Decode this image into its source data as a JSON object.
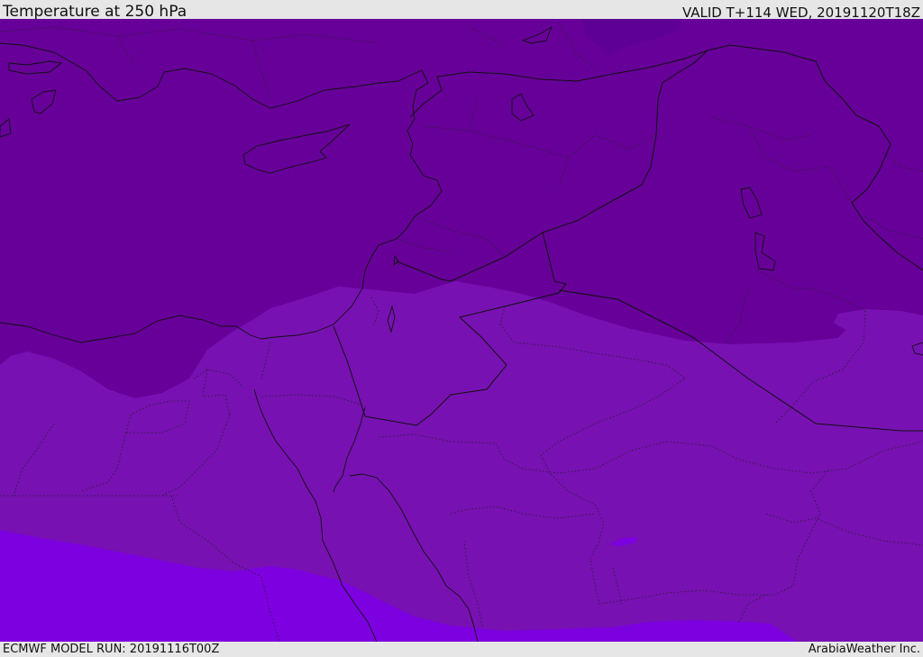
{
  "header": {
    "title": "Temperature at 250 hPa",
    "valid": "VALID T+114 WED, 20191120T18Z"
  },
  "footer": {
    "model_run": "ECMWF MODEL RUN: 20191116T00Z",
    "credit": "ArabiaWeather Inc."
  },
  "colors": {
    "band_coldest": "#5e0094",
    "band_cold": "#670099",
    "band_mid": "#7711b2",
    "band_warm": "#7d00e0",
    "coastline": "#111111",
    "frame": "#e6e6e6"
  }
}
